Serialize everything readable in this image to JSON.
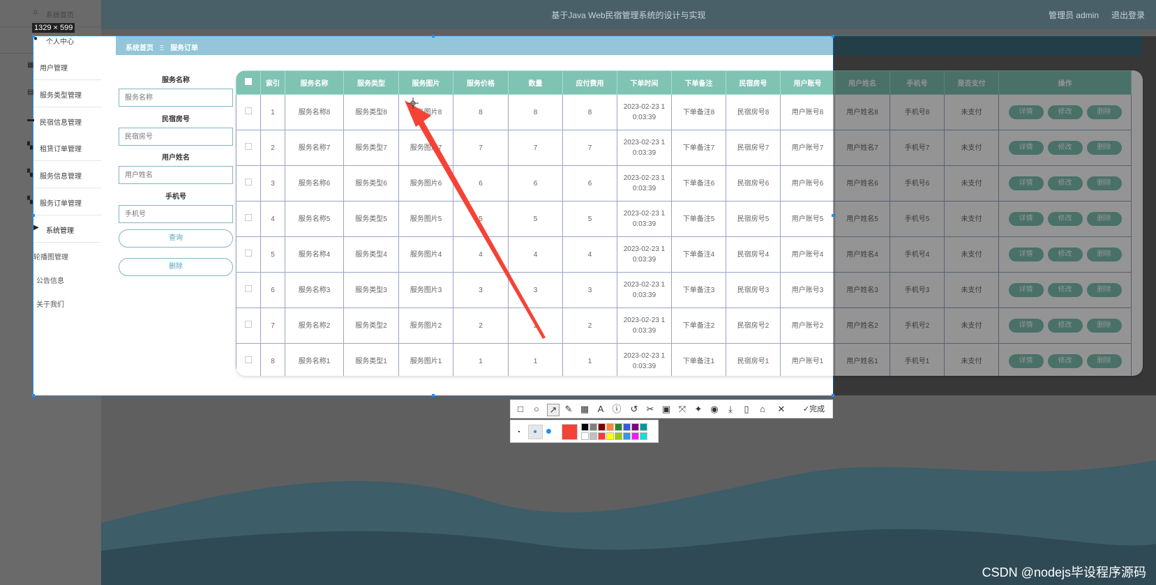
{
  "app": {
    "title": "基于Java Web民宿管理系统的设计与实现",
    "admin_label": "管理员 admin",
    "logout_label": "退出登录"
  },
  "sidebar": {
    "items": [
      {
        "label": "系统首页",
        "icon": "home-icon"
      },
      {
        "label": "个人中心",
        "icon": "user-icon"
      },
      {
        "label": "用户管理",
        "icon": "grid-icon"
      },
      {
        "label": "服务类型管理",
        "icon": "clipboard-icon"
      },
      {
        "label": "民宿信息管理",
        "icon": "briefcase-icon"
      },
      {
        "label": "租赁订单管理",
        "icon": "apps-icon"
      },
      {
        "label": "服务信息管理",
        "icon": "apps-icon"
      },
      {
        "label": "服务订单管理",
        "icon": "apps-icon"
      },
      {
        "label": "系统管理",
        "icon": "video-icon"
      }
    ],
    "sub_items": [
      "轮播图管理",
      "公告信息",
      "关于我们"
    ]
  },
  "breadcrumb": {
    "home": "系统首页",
    "separator": "Ξ",
    "current": "服务订单"
  },
  "search": {
    "fields": [
      {
        "label": "服务名称",
        "placeholder": "服务名称"
      },
      {
        "label": "民宿房号",
        "placeholder": "民宿房号"
      },
      {
        "label": "用户姓名",
        "placeholder": "用户姓名"
      },
      {
        "label": "手机号",
        "placeholder": "手机号"
      }
    ],
    "query_label": "查询",
    "delete_label": "删除"
  },
  "table": {
    "headers": [
      "索引",
      "服务名称",
      "服务类型",
      "服务图片",
      "服务价格",
      "数量",
      "应付费用",
      "下单时间",
      "下单备注",
      "民宿房号",
      "用户账号",
      "用户姓名",
      "手机号",
      "是否支付",
      "操作"
    ],
    "rows": [
      [
        "1",
        "服务名称8",
        "服务类型8",
        "服务图片8",
        "8",
        "8",
        "8",
        "2023-02-23 1",
        "0:03:39",
        "下单备注8",
        "民宿房号8",
        "用户账号8",
        "用户姓名8",
        "手机号8",
        "未支付"
      ],
      [
        "2",
        "服务名称7",
        "服务类型7",
        "服务图片7",
        "7",
        "7",
        "7",
        "2023-02-23 1",
        "0:03:39",
        "下单备注7",
        "民宿房号7",
        "用户账号7",
        "用户姓名7",
        "手机号7",
        "未支付"
      ],
      [
        "3",
        "服务名称6",
        "服务类型6",
        "服务图片6",
        "6",
        "6",
        "6",
        "2023-02-23 1",
        "0:03:39",
        "下单备注6",
        "民宿房号6",
        "用户账号6",
        "用户姓名6",
        "手机号6",
        "未支付"
      ],
      [
        "4",
        "服务名称5",
        "服务类型5",
        "服务图片5",
        "5",
        "5",
        "5",
        "2023-02-23 1",
        "0:03:39",
        "下单备注5",
        "民宿房号5",
        "用户账号5",
        "用户姓名5",
        "手机号5",
        "未支付"
      ],
      [
        "5",
        "服务名称4",
        "服务类型4",
        "服务图片4",
        "4",
        "4",
        "4",
        "2023-02-23 1",
        "0:03:39",
        "下单备注4",
        "民宿房号4",
        "用户账号4",
        "用户姓名4",
        "手机号4",
        "未支付"
      ],
      [
        "6",
        "服务名称3",
        "服务类型3",
        "服务图片3",
        "3",
        "3",
        "3",
        "2023-02-23 1",
        "0:03:39",
        "下单备注3",
        "民宿房号3",
        "用户账号3",
        "用户姓名3",
        "手机号3",
        "未支付"
      ],
      [
        "7",
        "服务名称2",
        "服务类型2",
        "服务图片2",
        "2",
        "2",
        "2",
        "2023-02-23 1",
        "0:03:39",
        "下单备注2",
        "民宿房号2",
        "用户账号2",
        "用户姓名2",
        "手机号2",
        "未支付"
      ],
      [
        "8",
        "服务名称1",
        "服务类型1",
        "服务图片1",
        "1",
        "1",
        "1",
        "2023-02-23 1",
        "0:03:39",
        "下单备注1",
        "民宿房号1",
        "用户账号1",
        "用户姓名1",
        "手机号1",
        "未支付"
      ]
    ],
    "actions": [
      "详情",
      "修改",
      "删除"
    ]
  },
  "screenshot_tool": {
    "size_label": "1329 × 599",
    "done_label": "完成",
    "annotation_color": "#f44336",
    "palette": [
      "#000000",
      "#808080",
      "#800000",
      "#f7883a",
      "#308430",
      "#385ad3",
      "#800080",
      "#009999",
      "#ffffff",
      "#c0c0c0",
      "#fb3838",
      "#ffff00",
      "#99cc00",
      "#3894e4",
      "#f31bf3",
      "#16dcdc"
    ]
  },
  "watermark": "CSDN @nodejs毕设程序源码",
  "colors": {
    "header_bg": "#4a6069",
    "table_head": "#7fc3b3",
    "crumb": "#94c5d8",
    "selection": "#1e90ff"
  }
}
